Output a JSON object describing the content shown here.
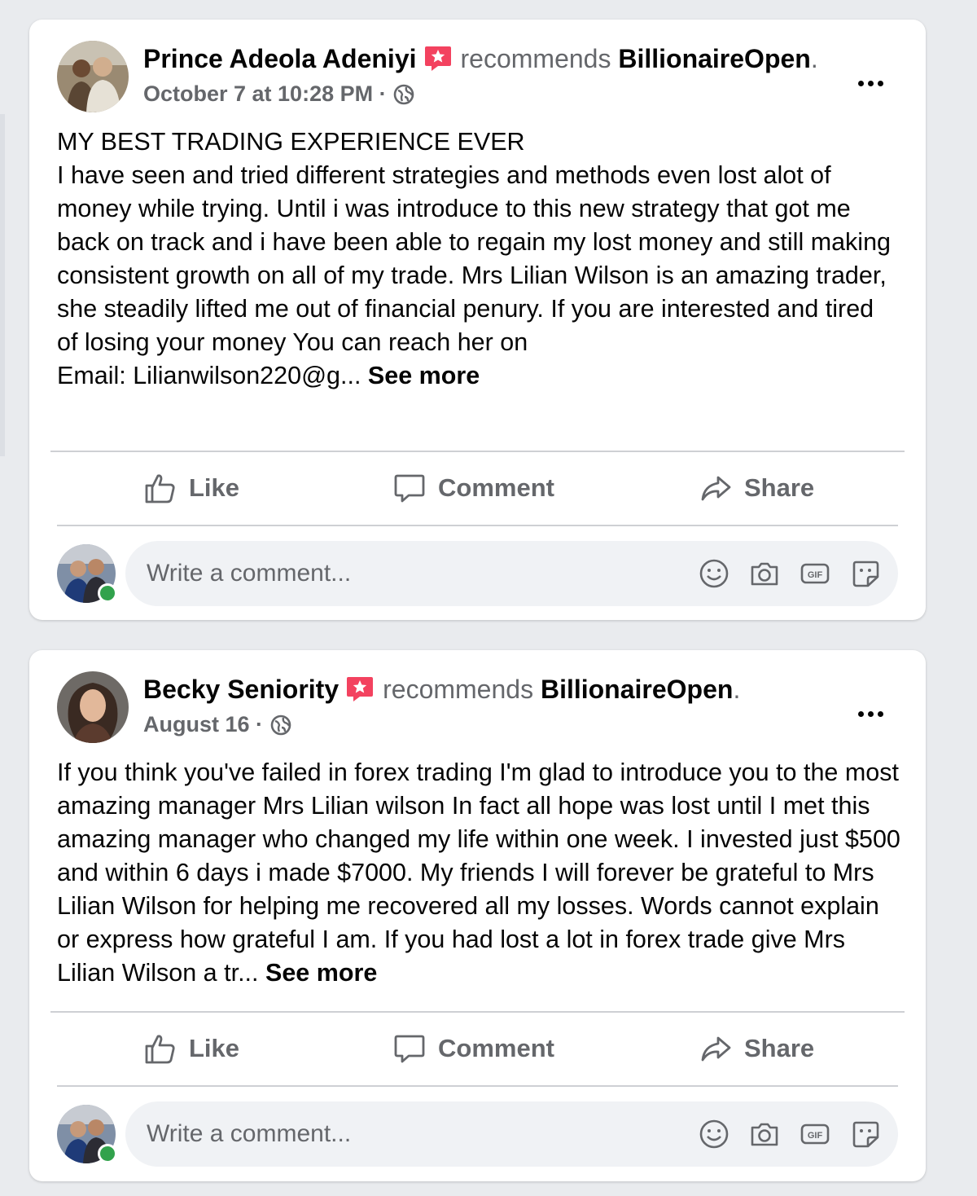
{
  "posts": [
    {
      "author": "Prince Adeola Adeniyi",
      "recommends_text": "recommends",
      "page": "BillionaireOpen",
      "period": ".",
      "timestamp": "October 7 at 10:28 PM",
      "separator": "·",
      "body_lines": [
        "MY BEST TRADING EXPERIENCE EVER",
        "I have seen and tried different strategies and methods even lost alot of money while trying. Until i was introduce to this new strategy that got me back on track and i have been able to regain my lost money and still making consistent growth on all of my trade. Mrs Lilian Wilson is an amazing trader, she steadily lifted me out of financial penury. If you are interested and tired of losing your money You can reach her on",
        "Email: Lilianwilson220@g..."
      ],
      "see_more": "See more",
      "actions": {
        "like": "Like",
        "comment": "Comment",
        "share": "Share"
      },
      "comment_placeholder": "Write a comment..."
    },
    {
      "author": "Becky Seniority",
      "recommends_text": "recommends",
      "page": "BillionaireOpen",
      "period": ".",
      "timestamp": "August 16",
      "separator": "·",
      "body_lines": [
        "If you think you've failed in forex trading I'm glad to introduce you to the most amazing manager Mrs Lilian wilson In fact all hope was lost until I met this amazing manager who changed my life within one week. I invested just $500 and within 6 days i made $7000. My friends I will forever be grateful to Mrs  Lilian Wilson for helping me recovered all my losses. Words cannot explain or express how grateful I am. If you had lost a lot in forex trade give Mrs Lilian Wilson a tr..."
      ],
      "see_more": "See more",
      "actions": {
        "like": "Like",
        "comment": "Comment",
        "share": "Share"
      },
      "comment_placeholder": "Write a comment..."
    }
  ],
  "icons": {
    "recommend_badge": "star-badge-icon",
    "privacy": "globe-icon",
    "more": "more-options-icon",
    "like": "thumbs-up-icon",
    "comment": "speech-bubble-icon",
    "share": "share-arrow-icon",
    "emoji": "smiley-icon",
    "photo": "camera-icon",
    "gif": "gif-icon",
    "sticker": "sticker-icon"
  },
  "colors": {
    "badge": "#f3425f",
    "secondary_text": "#65676b",
    "online": "#31a24c",
    "background": "#e9ebee"
  }
}
